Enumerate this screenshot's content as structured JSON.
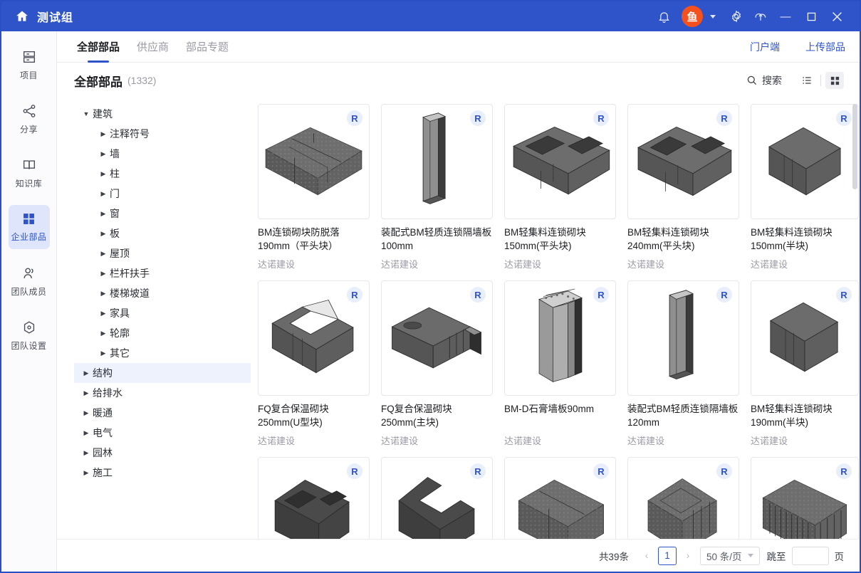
{
  "titlebar": {
    "app_title": "测试组",
    "home_icon": "home-icon",
    "bell_icon": "bell-icon",
    "avatar_text": "鱼",
    "gear_icon": "gear-icon",
    "cloud_icon": "cloud-upload-icon",
    "minimize": "—",
    "maximize": "▢",
    "close": "✕",
    "accent": "#2f53c8",
    "avatar_color": "#f4511e"
  },
  "rail": {
    "items": [
      {
        "label": "项目",
        "icon": "project-icon",
        "active": false
      },
      {
        "label": "分享",
        "icon": "share-icon",
        "active": false
      },
      {
        "label": "知识库",
        "icon": "book-icon",
        "active": false
      },
      {
        "label": "企业部品",
        "icon": "grid-icon",
        "active": true
      },
      {
        "label": "团队成员",
        "icon": "members-icon",
        "active": false
      },
      {
        "label": "团队设置",
        "icon": "settings-hex-icon",
        "active": false
      }
    ]
  },
  "tabs": {
    "items": [
      {
        "label": "全部部品",
        "active": true
      },
      {
        "label": "供应商",
        "active": false
      },
      {
        "label": "部品专题",
        "active": false
      }
    ],
    "links": [
      {
        "label": "门户端"
      },
      {
        "label": "上传部品"
      }
    ]
  },
  "pagehead": {
    "title": "全部部品",
    "count": "(1332)",
    "search_label": "搜索",
    "search_icon": "search-icon",
    "list_view_icon": "list-view-icon",
    "grid_view_icon": "grid-view-icon",
    "active_view": "grid"
  },
  "tree": {
    "nodes": [
      {
        "label": "建筑",
        "level": 1,
        "expanded": true,
        "highlight": false
      },
      {
        "label": "注释符号",
        "level": 2,
        "expanded": false,
        "highlight": false
      },
      {
        "label": "墙",
        "level": 2,
        "expanded": false,
        "highlight": false
      },
      {
        "label": "柱",
        "level": 2,
        "expanded": false,
        "highlight": false
      },
      {
        "label": "门",
        "level": 2,
        "expanded": false,
        "highlight": false
      },
      {
        "label": "窗",
        "level": 2,
        "expanded": false,
        "highlight": false
      },
      {
        "label": "板",
        "level": 2,
        "expanded": false,
        "highlight": false
      },
      {
        "label": "屋顶",
        "level": 2,
        "expanded": false,
        "highlight": false
      },
      {
        "label": "栏杆扶手",
        "level": 2,
        "expanded": false,
        "highlight": false
      },
      {
        "label": "楼梯坡道",
        "level": 2,
        "expanded": false,
        "highlight": false
      },
      {
        "label": "家具",
        "level": 2,
        "expanded": false,
        "highlight": false
      },
      {
        "label": "轮廓",
        "level": 2,
        "expanded": false,
        "highlight": false
      },
      {
        "label": "其它",
        "level": 2,
        "expanded": false,
        "highlight": false
      },
      {
        "label": "结构",
        "level": 1,
        "expanded": false,
        "highlight": true
      },
      {
        "label": "给排水",
        "level": 1,
        "expanded": false,
        "highlight": false
      },
      {
        "label": "暖通",
        "level": 1,
        "expanded": false,
        "highlight": false
      },
      {
        "label": "电气",
        "level": 1,
        "expanded": false,
        "highlight": false
      },
      {
        "label": "园林",
        "level": 1,
        "expanded": false,
        "highlight": false
      },
      {
        "label": "施工",
        "level": 1,
        "expanded": false,
        "highlight": false
      }
    ]
  },
  "cards": [
    {
      "title": "BM连锁砌块防脱落190mm（平头块）",
      "supplier": "达诺建设",
      "badge": "R",
      "shape": "block-dotted-double"
    },
    {
      "title": "装配式BM轻质连锁隔墙板100mm",
      "supplier": "达诺建设",
      "badge": "R",
      "shape": "panel-thin"
    },
    {
      "title": "BM轻集料连锁砌块150mm(平头块)",
      "supplier": "达诺建设",
      "badge": "R",
      "shape": "block-hollow-wide"
    },
    {
      "title": "BM轻集料连锁砌块240mm(平头块)",
      "supplier": "达诺建设",
      "badge": "R",
      "shape": "block-hollow-wide"
    },
    {
      "title": "BM轻集料连锁砌块150mm(半块)",
      "supplier": "达诺建设",
      "badge": "R",
      "shape": "block-solid-cube"
    },
    {
      "title": "FQ复合保温砌块250mm(U型块)",
      "supplier": "达诺建设",
      "badge": "R",
      "shape": "block-u-shape"
    },
    {
      "title": "FQ复合保温砌块250mm(主块)",
      "supplier": "达诺建设",
      "badge": "R",
      "shape": "block-ribbed"
    },
    {
      "title": "BM-D石膏墙板90mm",
      "supplier": "达诺建设",
      "badge": "R",
      "shape": "panel-grooved"
    },
    {
      "title": "装配式BM轻质连锁隔墙板120mm",
      "supplier": "达诺建设",
      "badge": "R",
      "shape": "panel-thin"
    },
    {
      "title": "BM轻集料连锁砌块190mm(半块)",
      "supplier": "达诺建设",
      "badge": "R",
      "shape": "block-solid-cube"
    },
    {
      "title": "",
      "supplier": "",
      "badge": "R",
      "shape": "block-hollow-wide"
    },
    {
      "title": "",
      "supplier": "",
      "badge": "R",
      "shape": "block-u-shape"
    },
    {
      "title": "",
      "supplier": "",
      "badge": "R",
      "shape": "block-dotted-double"
    },
    {
      "title": "",
      "supplier": "",
      "badge": "R",
      "shape": "block-dotted-cube"
    },
    {
      "title": "",
      "supplier": "",
      "badge": "R",
      "shape": "block-dotted-striped"
    }
  ],
  "pagination": {
    "total": "共39条",
    "prev": "‹",
    "next": "›",
    "current_page": "1",
    "page_size": "50 条/页",
    "jump_label": "跳至",
    "jump_value": "",
    "page_unit": "页"
  }
}
